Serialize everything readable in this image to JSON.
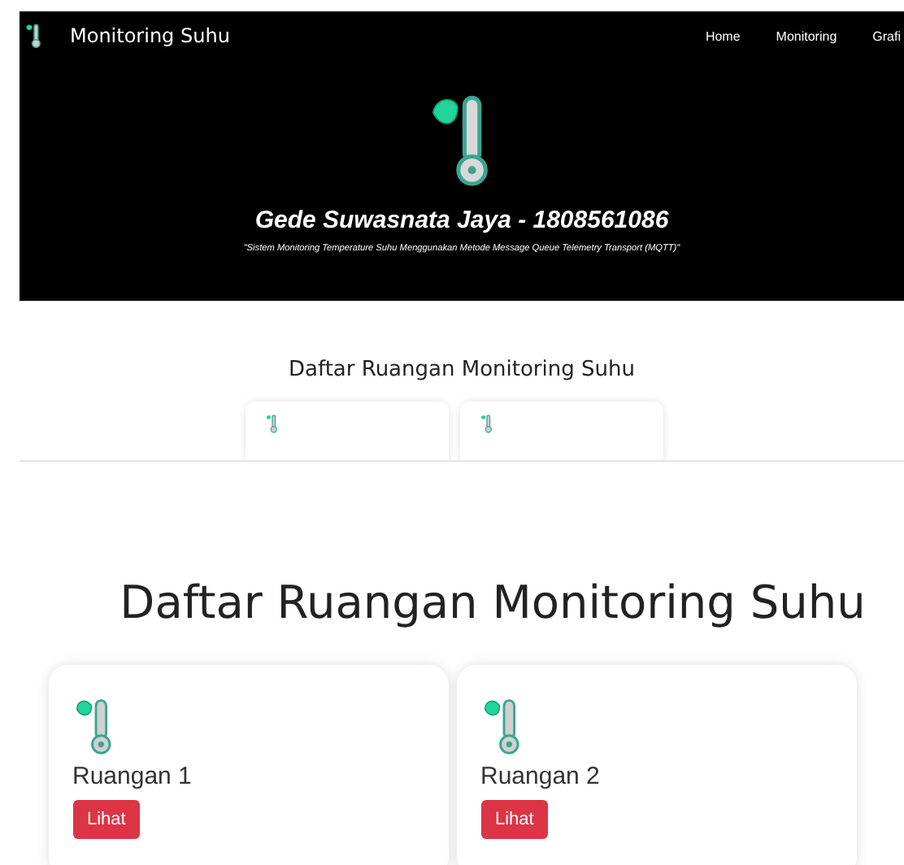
{
  "navbar": {
    "brand": "Monitoring Suhu",
    "links": [
      "Home",
      "Monitoring",
      "Grafi"
    ]
  },
  "hero": {
    "title": "Gede Suwasnata Jaya - 1808561086",
    "subtitle": "\"Sistem Monitoring Temperature Suhu Menggunakan Metode Message Queue Telemetry Transport (MQTT)\""
  },
  "preview_section": {
    "title": "Daftar Ruangan Monitoring Suhu",
    "cards": [
      {
        "kind": "thermometer"
      },
      {
        "kind": "thermometer"
      }
    ]
  },
  "room_section": {
    "title": "Daftar Ruangan Monitoring Suhu",
    "rooms": [
      {
        "name": "Ruangan 1",
        "button": "Lihat"
      },
      {
        "name": "Ruangan 2",
        "button": "Lihat"
      }
    ]
  }
}
